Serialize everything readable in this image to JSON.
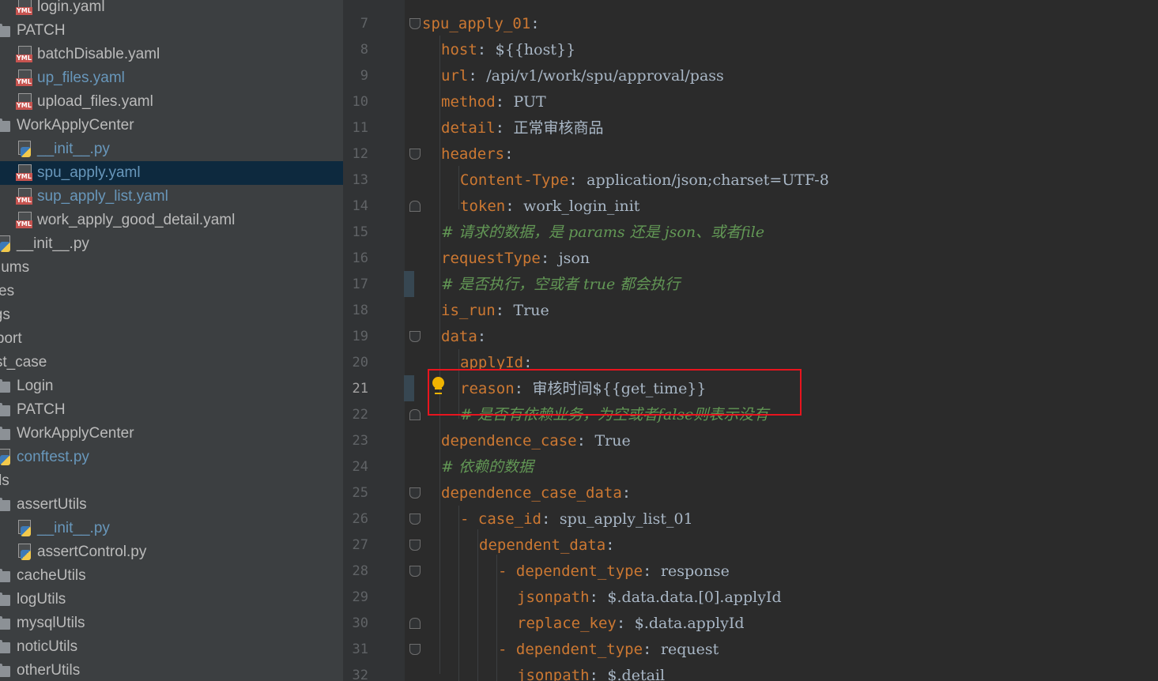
{
  "project_tree": {
    "items": [
      {
        "label": "login.yaml",
        "icon": "yaml-file-icon",
        "vcs": false
      },
      {
        "label": "PATCH",
        "icon": "folder-icon",
        "vcs": false
      },
      {
        "label": "batchDisable.yaml",
        "icon": "yaml-file-icon",
        "vcs": false
      },
      {
        "label": "up_files.yaml",
        "icon": "yaml-file-icon",
        "vcs": true
      },
      {
        "label": "upload_files.yaml",
        "icon": "yaml-file-icon",
        "vcs": false
      },
      {
        "label": "WorkApplyCenter",
        "icon": "folder-icon",
        "vcs": false
      },
      {
        "label": "__init__.py",
        "icon": "python-file-icon",
        "vcs": true
      },
      {
        "label": "spu_apply.yaml",
        "icon": "yaml-file-icon",
        "vcs": true,
        "selected": true
      },
      {
        "label": "sup_apply_list.yaml",
        "icon": "yaml-file-icon",
        "vcs": true
      },
      {
        "label": "work_apply_good_detail.yaml",
        "icon": "yaml-file-icon",
        "vcs": false
      },
      {
        "label": "__init__.py",
        "icon": "python-file-icon",
        "vcs": false
      },
      {
        "label": "Enums",
        "icon": "none",
        "vcs": false
      },
      {
        "label": "Files",
        "icon": "none",
        "vcs": false
      },
      {
        "label": "logs",
        "icon": "none",
        "vcs": false
      },
      {
        "label": "report",
        "icon": "none",
        "vcs": false
      },
      {
        "label": "test_case",
        "icon": "none",
        "vcs": false
      },
      {
        "label": "Login",
        "icon": "folder-icon",
        "vcs": false
      },
      {
        "label": "PATCH",
        "icon": "folder-icon",
        "vcs": false
      },
      {
        "label": "WorkApplyCenter",
        "icon": "folder-icon",
        "vcs": false
      },
      {
        "label": "conftest.py",
        "icon": "python-file-icon",
        "vcs": true
      },
      {
        "label": "utils",
        "icon": "none",
        "vcs": false
      },
      {
        "label": "assertUtils",
        "icon": "folder-icon",
        "vcs": false
      },
      {
        "label": "__init__.py",
        "icon": "python-file-icon",
        "vcs": true
      },
      {
        "label": "assertControl.py",
        "icon": "python-file-icon",
        "vcs": false
      },
      {
        "label": "cacheUtils",
        "icon": "folder-icon",
        "vcs": false
      },
      {
        "label": "logUtils",
        "icon": "folder-icon",
        "vcs": false
      },
      {
        "label": "mysqlUtils",
        "icon": "folder-icon",
        "vcs": false
      },
      {
        "label": "noticUtils",
        "icon": "folder-icon",
        "vcs": false
      },
      {
        "label": "otherUtils",
        "icon": "folder-icon",
        "vcs": false
      }
    ]
  },
  "editor": {
    "current_line": "21",
    "lines": [
      {
        "num": "7",
        "key": "spu_apply_01",
        "sep": ":",
        "value": ""
      },
      {
        "num": "8",
        "key": "host",
        "sep": ": ",
        "value": "${{host}}"
      },
      {
        "num": "9",
        "key": "url",
        "sep": ": ",
        "value": "/api/v1/work/spu/approval/pass"
      },
      {
        "num": "10",
        "key": "method",
        "sep": ": ",
        "value": "PUT"
      },
      {
        "num": "11",
        "key": "detail",
        "sep": ": ",
        "value": "正常审核商品"
      },
      {
        "num": "12",
        "key": "headers",
        "sep": ":",
        "value": ""
      },
      {
        "num": "13",
        "key": "Content-Type",
        "sep": ": ",
        "value": "application/json;charset=UTF-8"
      },
      {
        "num": "14",
        "key": "token",
        "sep": ": ",
        "value": "work_login_init"
      },
      {
        "num": "15",
        "comment": "# 请求的数据，是 params 还是 json、或者file"
      },
      {
        "num": "16",
        "key": "requestType",
        "sep": ": ",
        "value": "json"
      },
      {
        "num": "17",
        "comment": "# 是否执行，空或者 true 都会执行"
      },
      {
        "num": "18",
        "key": "is_run",
        "sep": ": ",
        "value": "True"
      },
      {
        "num": "19",
        "key": "data",
        "sep": ":",
        "value": ""
      },
      {
        "num": "20",
        "key": "applyId",
        "sep": ":",
        "value": ""
      },
      {
        "num": "21",
        "key": "reason",
        "sep": ": ",
        "value": "审核时间${{get_time}}"
      },
      {
        "num": "22",
        "comment": "# 是否有依赖业务，为空或者false则表示没有"
      },
      {
        "num": "23",
        "key": "dependence_case",
        "sep": ": ",
        "value": "True"
      },
      {
        "num": "24",
        "comment": "# 依赖的数据"
      },
      {
        "num": "25",
        "key": "dependence_case_data",
        "sep": ":",
        "value": ""
      },
      {
        "num": "26",
        "dash": "- ",
        "key": "case_id",
        "sep": ": ",
        "value": "spu_apply_list_01"
      },
      {
        "num": "27",
        "key": "dependent_data",
        "sep": ":",
        "value": ""
      },
      {
        "num": "28",
        "dash": "- ",
        "key": "dependent_type",
        "sep": ": ",
        "value": "response"
      },
      {
        "num": "29",
        "key": "jsonpath",
        "sep": ": ",
        "value": "$.data.data.[0].applyId"
      },
      {
        "num": "30",
        "key": "replace_key",
        "sep": ": ",
        "value": "$.data.applyId"
      },
      {
        "num": "31",
        "dash": "- ",
        "key": "dependent_type",
        "sep": ": ",
        "value": "request"
      },
      {
        "num": "32",
        "key": "jsonpath",
        "sep": ": ",
        "value": "$.detail"
      }
    ]
  }
}
